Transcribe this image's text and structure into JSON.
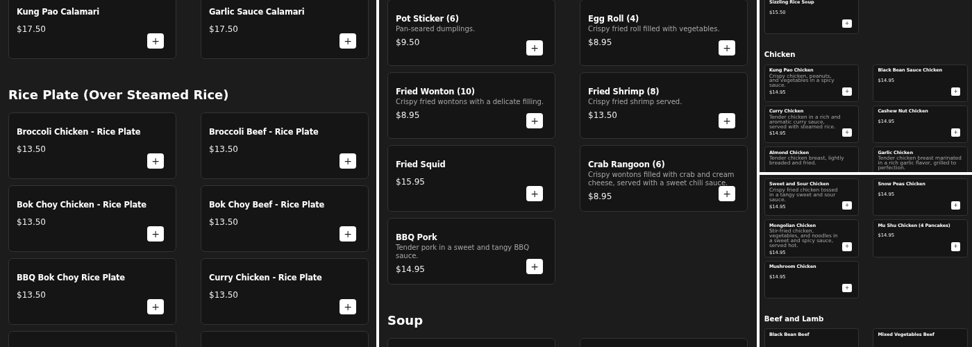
{
  "panels": [
    {
      "kind": "full",
      "pieces": [
        {
          "sections": [
            {
              "items": [
                {
                  "kind": "dish",
                  "name": "Kung Pao Calamari",
                  "price": "$17.50",
                  "add_label": "+"
                },
                {
                  "kind": "dish",
                  "name": "Garlic Sauce Calamari",
                  "price": "$17.50",
                  "add_label": "+"
                }
              ]
            },
            {
              "heading": "Rice Plate (Over Steamed Rice)",
              "items": [
                {
                  "kind": "dish",
                  "name": "Broccoli Chicken - Rice Plate",
                  "price": "$13.50",
                  "add_label": "+"
                },
                {
                  "kind": "dish",
                  "name": "Broccoli Beef - Rice Plate",
                  "price": "$13.50",
                  "add_label": "+"
                },
                {
                  "kind": "dish",
                  "name": "Bok Choy Chicken - Rice Plate",
                  "price": "$13.50",
                  "add_label": "+"
                },
                {
                  "kind": "dish",
                  "name": "Bok Choy Beef - Rice Plate",
                  "price": "$13.50",
                  "add_label": "+"
                },
                {
                  "kind": "dish",
                  "name": "BBQ Bok Choy Rice Plate",
                  "price": "$13.50",
                  "add_label": "+"
                },
                {
                  "kind": "dish",
                  "name": "Curry Chicken - Rice Plate",
                  "price": "$13.50",
                  "add_label": "+"
                },
                {
                  "kind": "cut"
                },
                {
                  "kind": "cut"
                }
              ]
            }
          ]
        }
      ]
    },
    {
      "kind": "full",
      "pieces": [
        {
          "sections": [
            {
              "items": [
                {
                  "kind": "dish",
                  "name": "Pot Sticker (6)",
                  "description": "Pan-seared dumplings.",
                  "price": "$9.50",
                  "add_label": "+"
                },
                {
                  "kind": "dish",
                  "name": "Egg Roll (4)",
                  "description": "Crispy fried roll filled with vegetables.",
                  "price": "$8.95",
                  "add_label": "+"
                },
                {
                  "kind": "dish",
                  "name": "Fried Wonton (10)",
                  "description": "Crispy fried wontons with a delicate filling.",
                  "price": "$8.95",
                  "add_label": "+"
                },
                {
                  "kind": "dish",
                  "name": "Fried Shrimp (8)",
                  "description": "Crispy fried shrimp served.",
                  "price": "$13.50",
                  "add_label": "+"
                },
                {
                  "kind": "dish",
                  "name": "Fried Squid",
                  "price": "$15.95",
                  "add_label": "+"
                },
                {
                  "kind": "dish",
                  "name": "Crab Rangoon (6)",
                  "description": "Crispy wontons filled with crab and cream cheese, served with a sweet chili sauce.",
                  "price": "$8.95",
                  "add_label": "+"
                },
                {
                  "kind": "dish",
                  "name": "BBQ Pork",
                  "description": "Tender pork in a sweet and tangy BBQ sauce.",
                  "price": "$14.95",
                  "add_label": "+"
                }
              ]
            },
            {
              "heading": "Soup",
              "items": [
                {
                  "kind": "cut"
                },
                {
                  "kind": "cut"
                }
              ]
            }
          ]
        }
      ]
    },
    {
      "kind": "compact",
      "pieces": [
        {
          "sections": [
            {
              "items": [
                {
                  "kind": "dish",
                  "name": "Sizzling Rice Soup",
                  "price": "$15.50",
                  "add_label": "+"
                }
              ]
            },
            {
              "heading": "Chicken",
              "items": [
                {
                  "kind": "dish",
                  "name": "Kung Pao Chicken",
                  "description": "Crispy chicken, peanuts, and vegetables in a spicy sauce.",
                  "price": "$14.95",
                  "add_label": "+"
                },
                {
                  "kind": "dish",
                  "name": "Black Bean Sauce Chicken",
                  "price": "$14.95",
                  "add_label": "+"
                },
                {
                  "kind": "dish",
                  "name": "Curry Chicken",
                  "description": "Tender chicken in a rich and aromatic curry sauce, served with steamed rice.",
                  "price": "$14.95",
                  "add_label": "+"
                },
                {
                  "kind": "dish",
                  "name": "Cashew Nut Chicken",
                  "price": "$14.95",
                  "add_label": "+"
                },
                {
                  "kind": "dish",
                  "name": "Almond Chicken",
                  "description": "Tender chicken breast, lightly breaded and fried."
                },
                {
                  "kind": "dish",
                  "name": "Garlic Chicken",
                  "description": "Tender chicken breast marinated in a rich garlic flavor, grilled to perfection."
                }
              ]
            }
          ]
        },
        {
          "sections": [
            {
              "items": [
                {
                  "kind": "dish",
                  "name": "Sweet and Sour Chicken",
                  "description": "Crispy fried chicken tossed in a tangy sweet and sour sauce.",
                  "price": "$14.95",
                  "add_label": "+"
                },
                {
                  "kind": "dish",
                  "name": "Snow Peas Chicken",
                  "price": "$14.95",
                  "add_label": "+"
                },
                {
                  "kind": "dish",
                  "name": "Mongolian Chicken",
                  "description": "Stir-fried chicken, vegetables, and noodles in a sweet and spicy sauce, served hot.",
                  "price": "$14.95",
                  "add_label": "+"
                },
                {
                  "kind": "dish",
                  "name": "Mu Shu Chicken (4 Pancakes)",
                  "price": "$14.95",
                  "add_label": "+"
                },
                {
                  "kind": "dish",
                  "name": "Mushroom Chicken",
                  "price": "$14.95",
                  "add_label": "+"
                }
              ]
            },
            {
              "heading": "Beef and Lamb",
              "items": [
                {
                  "kind": "dish",
                  "name": "Black Bean Beef"
                },
                {
                  "kind": "dish",
                  "name": "Mixed Vegetables Beef"
                }
              ]
            }
          ]
        }
      ]
    }
  ]
}
